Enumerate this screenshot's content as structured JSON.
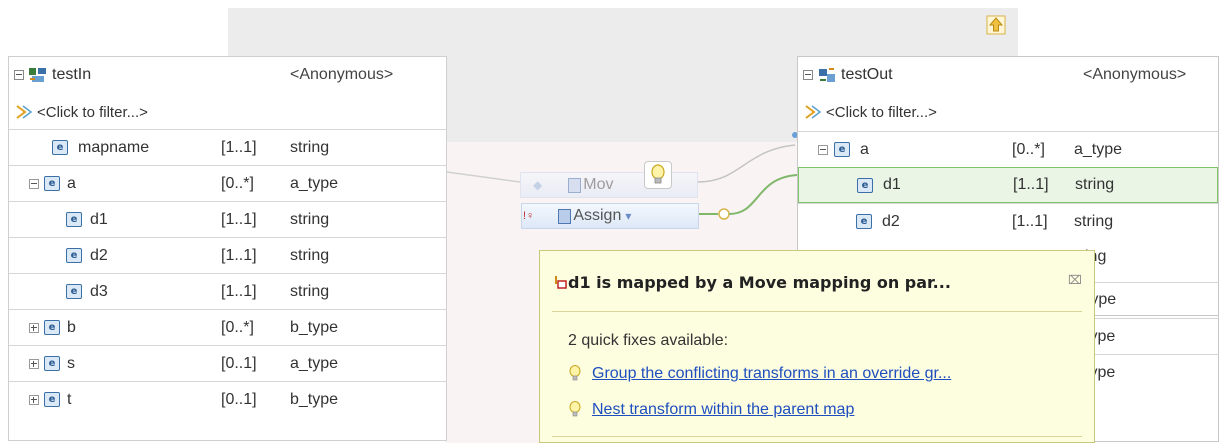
{
  "canvas": {
    "nav_icon": "navigate-up-icon"
  },
  "input": {
    "name": "testIn",
    "type": "<Anonymous>",
    "filter_placeholder": "<Click to filter...>",
    "rows": [
      {
        "name": "mapname",
        "card": "[1..1]",
        "type": "string",
        "toggle": "none",
        "indent": 0
      },
      {
        "name": "a",
        "card": "[0..*]",
        "type": "a_type",
        "toggle": "minus",
        "indent": 0
      },
      {
        "name": "d1",
        "card": "[1..1]",
        "type": "string",
        "toggle": "none",
        "indent": 1
      },
      {
        "name": "d2",
        "card": "[1..1]",
        "type": "string",
        "toggle": "none",
        "indent": 1
      },
      {
        "name": "d3",
        "card": "[1..1]",
        "type": "string",
        "toggle": "none",
        "indent": 1
      },
      {
        "name": "b",
        "card": "[0..*]",
        "type": "b_type",
        "toggle": "plus",
        "indent": 0
      },
      {
        "name": "s",
        "card": "[0..1]",
        "type": "a_type",
        "toggle": "plus",
        "indent": 0
      },
      {
        "name": "t",
        "card": "[0..1]",
        "type": "b_type",
        "toggle": "plus",
        "indent": 0
      }
    ]
  },
  "output": {
    "name": "testOut",
    "type": "<Anonymous>",
    "filter_placeholder": "<Click to filter...>",
    "rows": [
      {
        "name": "a",
        "card": "[0..*]",
        "type": "a_type"
      },
      {
        "name": "d1",
        "card": "[1..1]",
        "type": "string"
      },
      {
        "name": "d2",
        "card": "[1..1]",
        "type": "string"
      }
    ],
    "partial_types": [
      "ing",
      "_type",
      "type",
      "type"
    ]
  },
  "transforms": {
    "move_label": "Mov",
    "assign_label": "Assign",
    "assign_dropdown": "▾"
  },
  "popup": {
    "title": "d1 is mapped by a Move mapping on par...",
    "close": "⌧",
    "message": "2 quick fixes available:",
    "fixes": [
      "Group the conflicting transforms in an override gr...",
      "Nest transform within the parent map"
    ]
  },
  "colors": {
    "accent_green": "#7fc46b",
    "link_blue": "#1f4fbf",
    "popup_bg": "#fdfde0"
  }
}
